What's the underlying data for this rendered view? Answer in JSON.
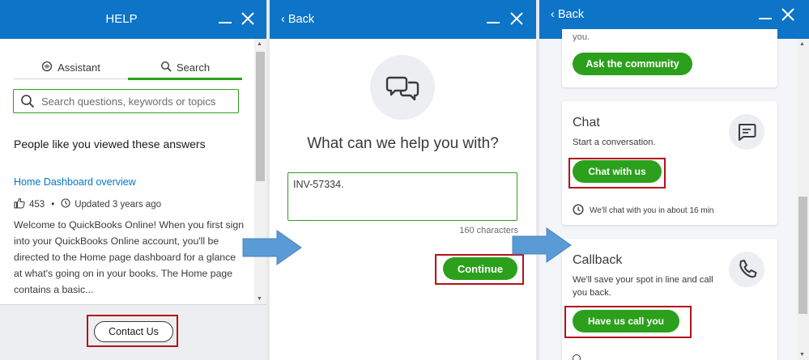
{
  "colors": {
    "header_blue": "#0d74c7",
    "brand_green": "#2ca01c",
    "highlight_red": "#b3121b",
    "link_blue": "#0077c5"
  },
  "panel1": {
    "header_title": "HELP",
    "tabs": [
      {
        "label": "Assistant",
        "icon": "assistant-icon"
      },
      {
        "label": "Search",
        "icon": "search-icon",
        "active": true
      }
    ],
    "search_placeholder": "Search questions, keywords or topics",
    "section_title": "People like you viewed these answers",
    "article": {
      "title": "Home Dashboard overview",
      "likes": "453",
      "separator": "•",
      "updated": "Updated 3 years ago",
      "snippet": "Welcome to QuickBooks Online! When you first sign into your QuickBooks Online account, you'll be directed to the Home page dashboard for a glance at what's going on in your books. The Home page contains a basic..."
    },
    "contact_button": "Contact Us"
  },
  "panel2": {
    "back_label": "Back",
    "question": "What can we help you with?",
    "textarea_value": "INV-57334.",
    "chars_left": "160 characters",
    "continue_button": "Continue"
  },
  "panel3": {
    "back_label": "Back",
    "top_card_fragment": "you.",
    "community_button": "Ask the community",
    "chat": {
      "title": "Chat",
      "subtitle": "Start a conversation.",
      "button": "Chat with us",
      "wait": "We'll chat with you in about 16 min"
    },
    "callback": {
      "title": "Callback",
      "subtitle": "We'll save your spot in line and call you back.",
      "button": "Have us call you"
    }
  }
}
